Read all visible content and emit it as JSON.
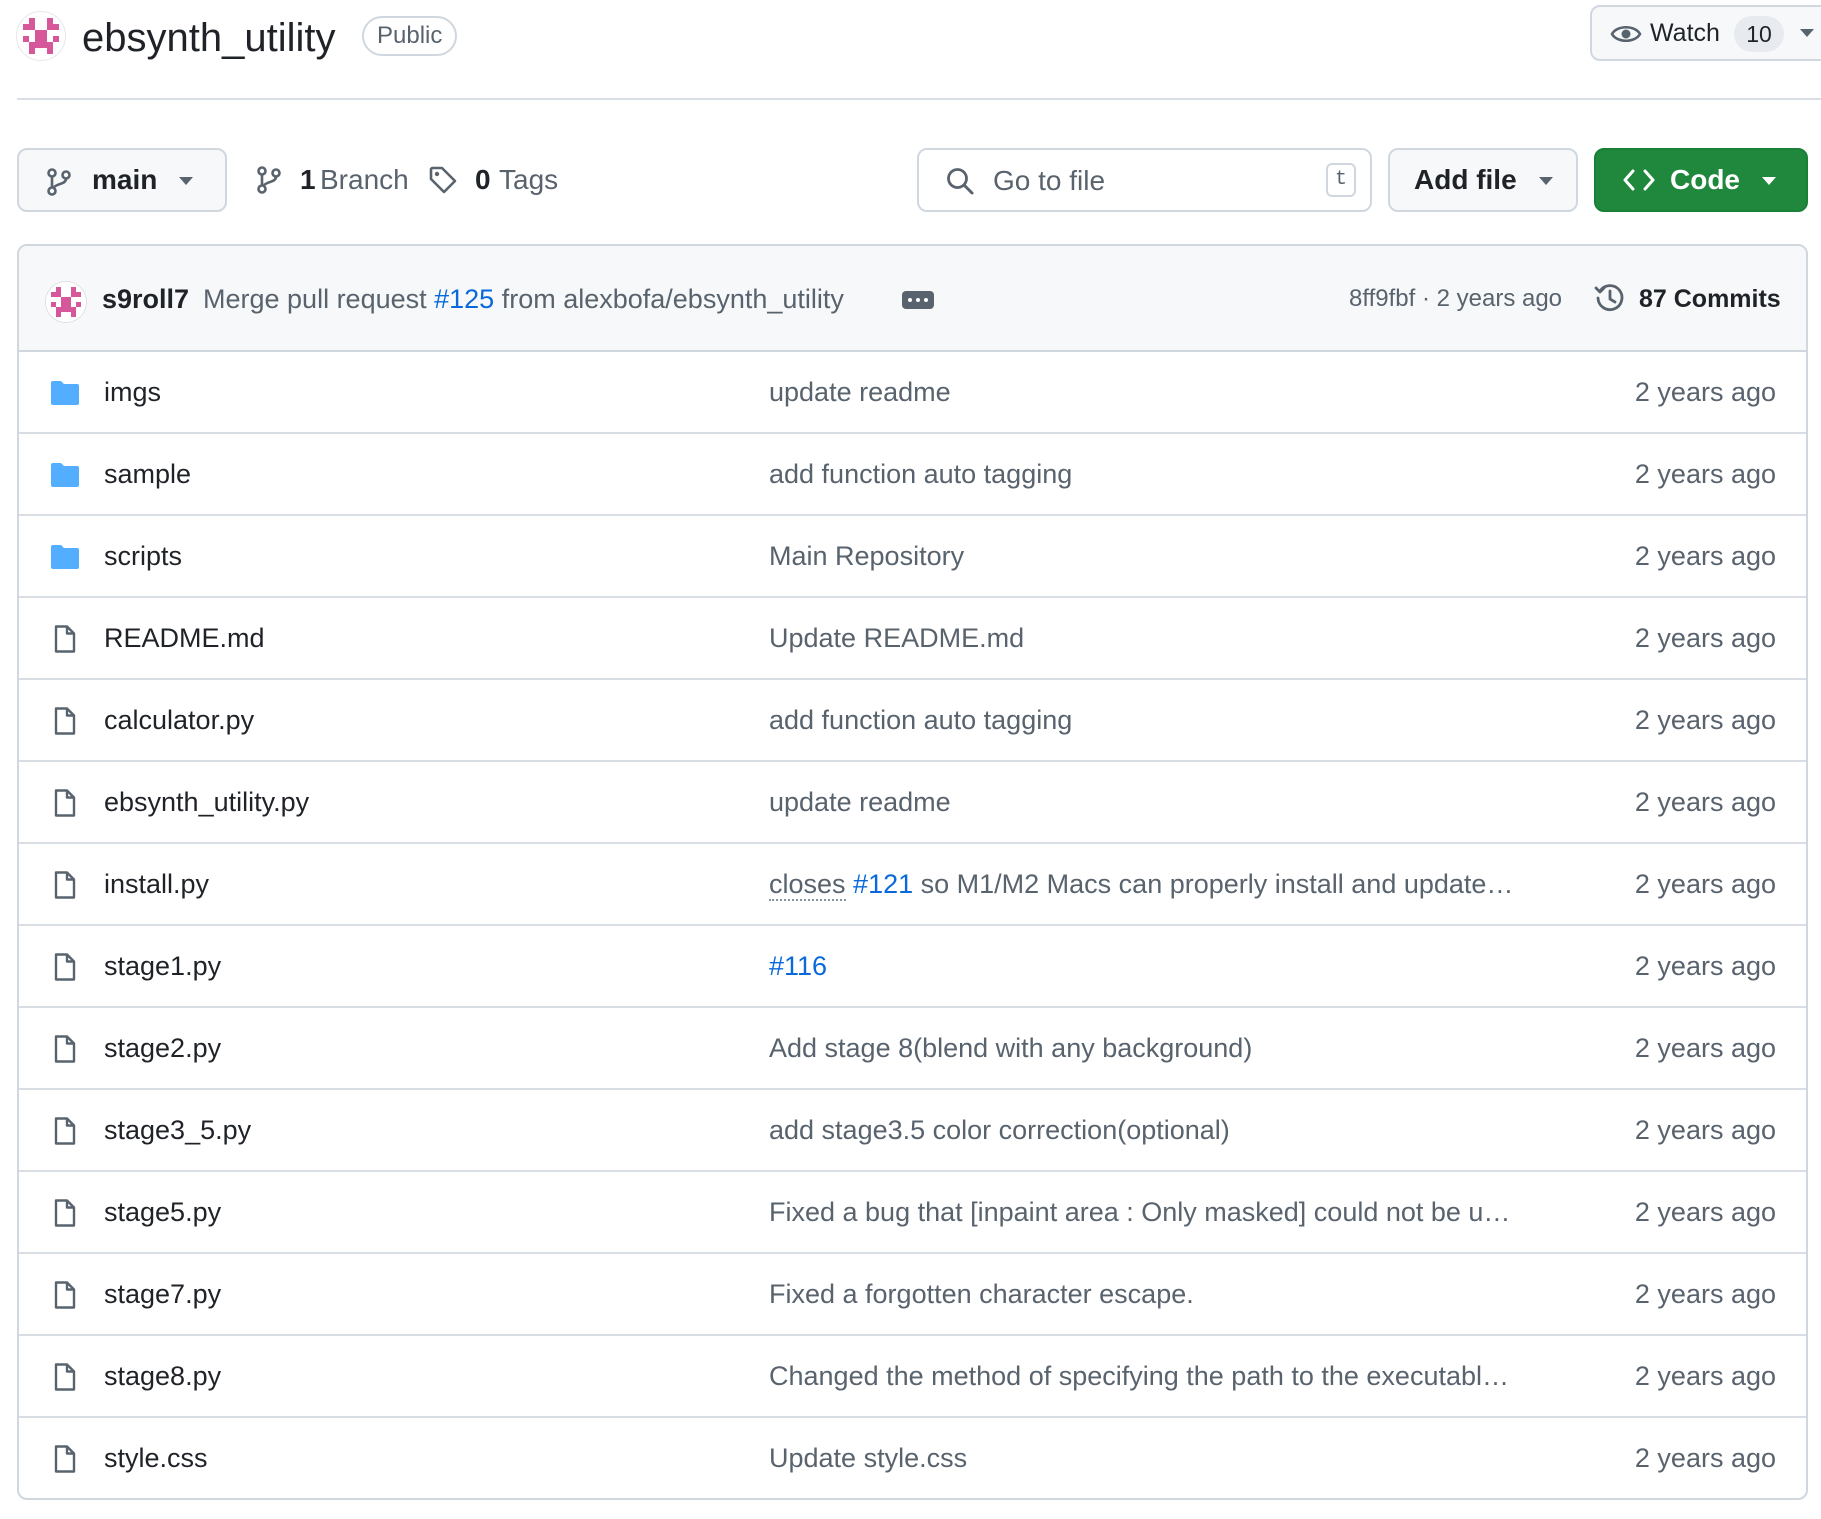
{
  "header": {
    "repo_name": "ebsynth_utility",
    "visibility": "Public",
    "watch": {
      "label": "Watch",
      "count": "10"
    }
  },
  "toolbar": {
    "branch": "main",
    "branches": {
      "count": "1",
      "label": "Branch"
    },
    "tags": {
      "count": "0",
      "label": "Tags"
    },
    "search": {
      "placeholder": "Go to file",
      "shortcut": "t"
    },
    "add_file_label": "Add file",
    "code_label": "Code"
  },
  "latest_commit": {
    "author": "s9roll7",
    "message_prefix": "Merge pull request ",
    "pr_link": "#125",
    "message_suffix": " from alexbofa/ebsynth_utility",
    "hash": "8ff9fbf",
    "time": "2 years ago",
    "commits_label": "87 Commits"
  },
  "files": [
    {
      "type": "folder",
      "name": "imgs",
      "message": "update readme",
      "date": "2 years ago"
    },
    {
      "type": "folder",
      "name": "sample",
      "message": "add function auto tagging",
      "date": "2 years ago"
    },
    {
      "type": "folder",
      "name": "scripts",
      "message": "Main Repository",
      "date": "2 years ago"
    },
    {
      "type": "file",
      "name": "README.md",
      "message": "Update README.md",
      "date": "2 years ago"
    },
    {
      "type": "file",
      "name": "calculator.py",
      "message": "add function auto tagging",
      "date": "2 years ago"
    },
    {
      "type": "file",
      "name": "ebsynth_utility.py",
      "message": "update readme",
      "date": "2 years ago"
    },
    {
      "type": "file",
      "name": "install.py",
      "message_prefix": "closes",
      "message_link": "#121",
      "message": "so M1/M2 Macs can properly install and update…",
      "date": "2 years ago"
    },
    {
      "type": "file",
      "name": "stage1.py",
      "message_link": "#116",
      "message": "",
      "date": "2 years ago"
    },
    {
      "type": "file",
      "name": "stage2.py",
      "message": "Add stage 8(blend with any background)",
      "date": "2 years ago"
    },
    {
      "type": "file",
      "name": "stage3_5.py",
      "message": "add stage3.5 color correction(optional)",
      "date": "2 years ago"
    },
    {
      "type": "file",
      "name": "stage5.py",
      "message": "Fixed a bug that [inpaint area : Only masked] could not be u…",
      "date": "2 years ago"
    },
    {
      "type": "file",
      "name": "stage7.py",
      "message": "Fixed a forgotten character escape.",
      "date": "2 years ago"
    },
    {
      "type": "file",
      "name": "stage8.py",
      "message": "Changed the method of specifying the path to the executabl…",
      "date": "2 years ago"
    },
    {
      "type": "file",
      "name": "style.css",
      "message": "Update style.css",
      "date": "2 years ago"
    }
  ],
  "colors": {
    "accent_link": "#0969da",
    "code_button": "#1f883d",
    "folder_icon": "#54aeff",
    "avatar_pink": "#d6579a"
  },
  "icons": {
    "watch": "eye-icon",
    "branch": "git-branch-icon",
    "tag": "tag-icon",
    "search": "search-icon",
    "code": "code-icon",
    "history": "history-icon",
    "folder": "folder-icon",
    "file": "file-icon"
  }
}
